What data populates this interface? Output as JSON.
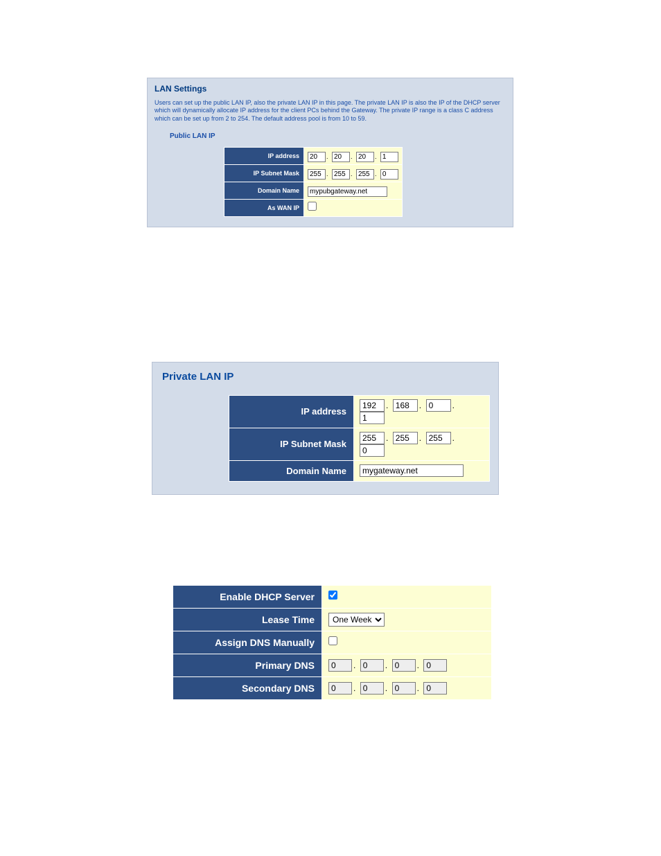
{
  "panel1": {
    "title": "LAN Settings",
    "description": "Users can set up the public LAN IP, also the private LAN IP in this page. The private LAN IP is also the IP of the DHCP server which will dynamically allocate IP address for the client PCs behind the Gateway. The private IP range is a class C address which can be set up from 2 to 254. The default address pool is from 10 to 59.",
    "subhead": "Public LAN IP",
    "rows": {
      "ip_address": {
        "label": "IP address",
        "octets": [
          "20",
          "20",
          "20",
          "1"
        ]
      },
      "ip_subnet_mask": {
        "label": "IP Subnet Mask",
        "octets": [
          "255",
          "255",
          "255",
          "0"
        ]
      },
      "domain_name": {
        "label": "Domain Name",
        "value": "mypubgateway.net"
      },
      "as_wan_ip": {
        "label": "As WAN IP",
        "checked": false
      }
    }
  },
  "panel2": {
    "title": "Private LAN IP",
    "rows": {
      "ip_address": {
        "label": "IP address",
        "octets": [
          "192",
          "168",
          "0",
          "1"
        ]
      },
      "ip_subnet_mask": {
        "label": "IP Subnet Mask",
        "octets": [
          "255",
          "255",
          "255",
          "0"
        ]
      },
      "domain_name": {
        "label": "Domain Name",
        "value": "mygateway.net"
      }
    }
  },
  "panel3": {
    "rows": {
      "enable_dhcp": {
        "label": "Enable DHCP Server",
        "checked": true
      },
      "lease_time": {
        "label": "Lease Time",
        "value": "One Week",
        "options": [
          "One Week"
        ]
      },
      "assign_dns": {
        "label": "Assign DNS Manually",
        "checked": false
      },
      "primary_dns": {
        "label": "Primary DNS",
        "octets": [
          "0",
          "0",
          "0",
          "0"
        ]
      },
      "secondary_dns": {
        "label": "Secondary DNS",
        "octets": [
          "0",
          "0",
          "0",
          "0"
        ]
      }
    }
  }
}
